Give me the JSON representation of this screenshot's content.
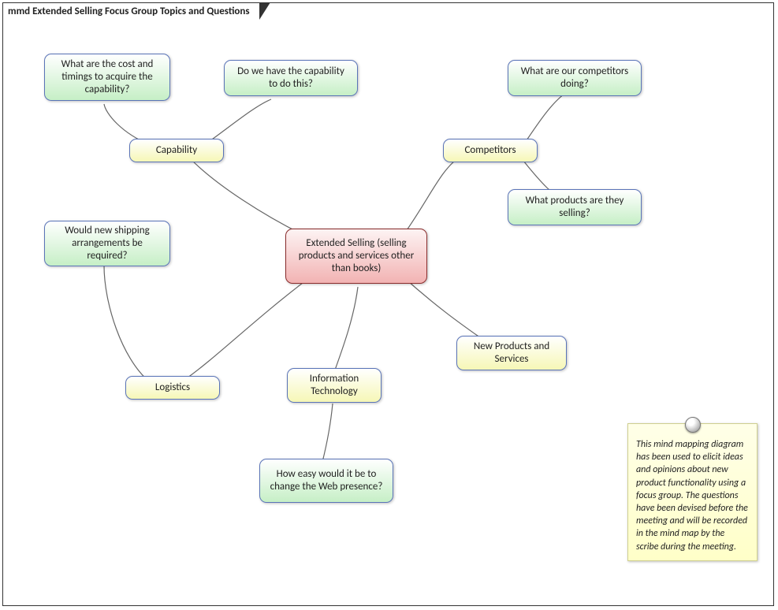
{
  "title": "mmd Extended Selling Focus Group Topics and Questions",
  "central": "Extended Selling (selling products and services other than books)",
  "topics": {
    "capability": "Capability",
    "competitors": "Competitors",
    "logistics": "Logistics",
    "infoTech": "Information Technology",
    "newProducts": "New Products and Services"
  },
  "questions": {
    "costTiming": "What are the cost and timings to acquire the capability?",
    "haveCapability": "Do we have the capability to do this?",
    "competitorsDoing": "What are our competitors doing?",
    "competitorsProducts": "What products are they selling?",
    "shipping": "Would new shipping arrangements be required?",
    "webPresence": "How easy would it be to change the Web presence?"
  },
  "note": "This mind mapping diagram has been used to elicit ideas and opinions about new product functionality using a focus group. The questions have been devised before the meeting and will be recorded in the mind map by the scribe during the meeting."
}
